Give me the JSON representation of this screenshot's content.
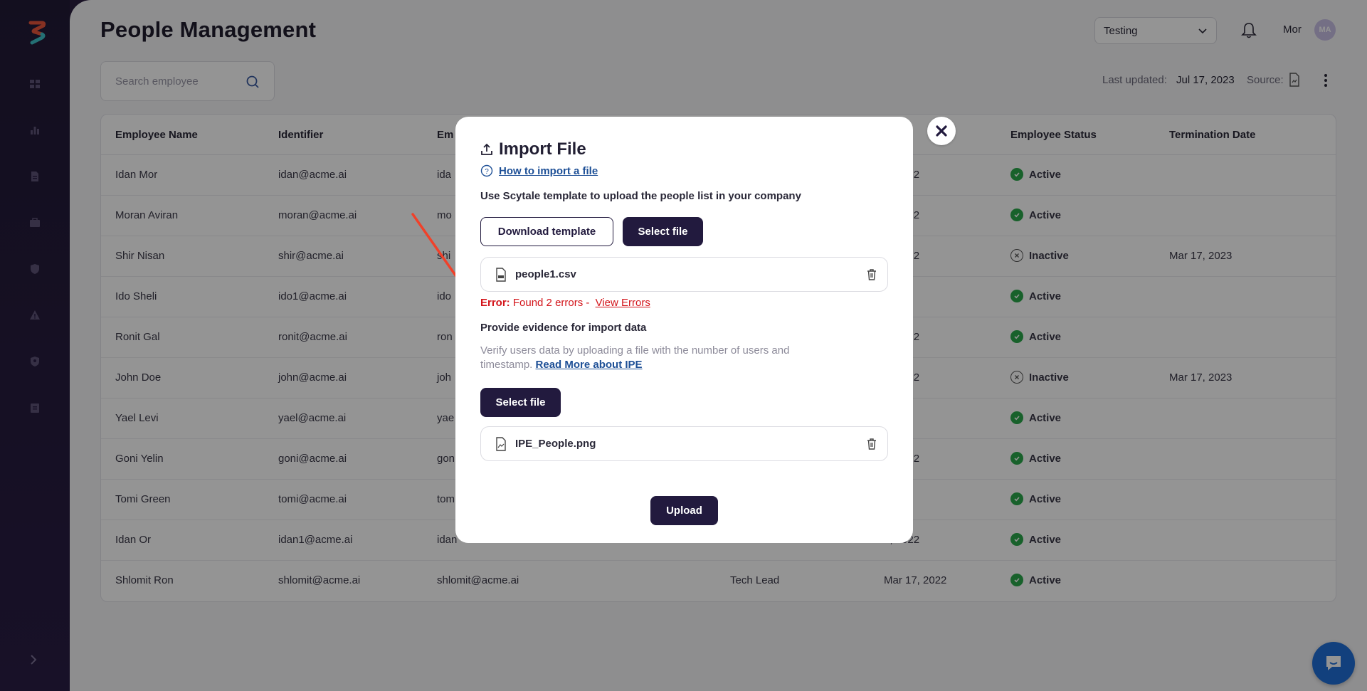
{
  "sidebar": {
    "nav_icons": [
      "dashboard-icon",
      "chart-icon",
      "document-icon",
      "briefcase-icon",
      "shield-icon",
      "warning-icon",
      "user-shield-icon",
      "clipboard-icon"
    ],
    "collapse_icon": "chevron-right-icon"
  },
  "header": {
    "title": "People Management",
    "env_select_value": "Testing",
    "user_name": "Mor",
    "avatar_initials": "MA"
  },
  "search": {
    "placeholder": "Search employee"
  },
  "meta": {
    "last_updated_label": "Last updated:",
    "last_updated_value": "Jul 17, 2023",
    "source_label": "Source:"
  },
  "table": {
    "columns": [
      "Employee Name",
      "Identifier",
      "Em",
      "",
      "g D",
      "Employee Status",
      "Termination Date"
    ],
    "rows": [
      {
        "name": "Idan Mor",
        "identifier": "idan@acme.ai",
        "email": "ida",
        "role": "",
        "start": "7, 2022",
        "status": "Active",
        "termination": ""
      },
      {
        "name": "Moran Aviran",
        "identifier": "moran@acme.ai",
        "email": "mo",
        "role": "",
        "start": "7, 2022",
        "status": "Active",
        "termination": ""
      },
      {
        "name": "Shir Nisan",
        "identifier": "shir@acme.ai",
        "email": "shi",
        "role": "",
        "start": "7, 2022",
        "status": "Inactive",
        "termination": "Mar 17, 2023"
      },
      {
        "name": "Ido Sheli",
        "identifier": "ido1@acme.ai",
        "email": "ido",
        "role": "",
        "start": "2022",
        "status": "Active",
        "termination": ""
      },
      {
        "name": "Ronit Gal",
        "identifier": "ronit@acme.ai",
        "email": "ron",
        "role": "",
        "start": "7, 2022",
        "status": "Active",
        "termination": ""
      },
      {
        "name": "John Doe",
        "identifier": "john@acme.ai",
        "email": "joh",
        "role": "",
        "start": "4, 2022",
        "status": "Inactive",
        "termination": "Mar 17, 2023"
      },
      {
        "name": "Yael Levi",
        "identifier": "yael@acme.ai",
        "email": "yae",
        "role": "",
        "start": "2022",
        "status": "Active",
        "termination": ""
      },
      {
        "name": "Goni Yelin",
        "identifier": "goni@acme.ai",
        "email": "gon",
        "role": "",
        "start": "7, 2022",
        "status": "Active",
        "termination": ""
      },
      {
        "name": "Tomi Green",
        "identifier": "tomi@acme.ai",
        "email": "tom",
        "role": "",
        "start": "2022",
        "status": "Active",
        "termination": ""
      },
      {
        "name": "Idan Or",
        "identifier": "idan1@acme.ai",
        "email": "idan",
        "role": "",
        "start": "7, 2022",
        "status": "Active",
        "termination": ""
      },
      {
        "name": "Shlomit Ron",
        "identifier": "shlomit@acme.ai",
        "email": "shlomit@acme.ai",
        "role": "Tech Lead",
        "start": "Mar 17, 2022",
        "status": "Active",
        "termination": ""
      }
    ]
  },
  "modal": {
    "title": "Import File",
    "help_link": "How to import a file",
    "subtitle": "Use Scytale template to upload the people list in your company",
    "download_template_label": "Download template",
    "select_file_label": "Select file",
    "file1_name": "people1.csv",
    "error_label": "Error:",
    "error_text": "Found 2 errors -",
    "view_errors_link": "View Errors",
    "evidence_title": "Provide evidence for import data",
    "evidence_desc": "Verify users data by uploading a file with the number of users and timestamp.",
    "evidence_link": "Read More about IPE",
    "select_file2_label": "Select file",
    "file2_name": "IPE_People.png",
    "upload_label": "Upload"
  },
  "colors": {
    "brand_dark": "#221a3e",
    "error": "#d3141a",
    "active": "#2aa84a",
    "link": "#1d4f96",
    "annotation_arrow": "#f0412a"
  }
}
